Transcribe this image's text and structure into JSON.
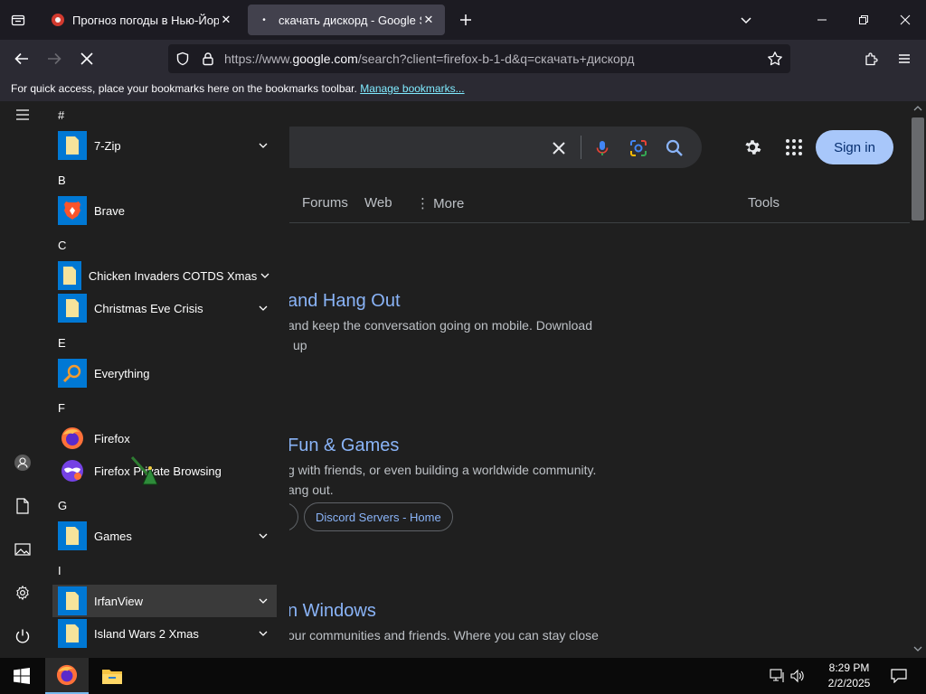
{
  "browser": {
    "tabs": [
      {
        "title": "Прогноз погоды в Нью-Йорке",
        "active": false
      },
      {
        "title": "скачать дискорд - Google Search",
        "active": true
      }
    ],
    "url": {
      "prefix": "https://www.",
      "host": "google.com",
      "rest": "/search?client=firefox-b-1-d&q=скачать+дискорд"
    },
    "bookmarks_notice": "For quick access, place your bookmarks here on the bookmarks toolbar.",
    "manage_bookmarks": "Manage bookmarks..."
  },
  "google": {
    "sign_in": "Sign in",
    "tabs": [
      "Forums",
      "Web",
      "More"
    ],
    "tools": "Tools",
    "results": [
      {
        "title": "and Hang Out",
        "line1": "and keep the conversation going on mobile. Download",
        "line2": "up"
      },
      {
        "title": "Fun & Games",
        "line1": "g with friends, or even building a worldwide community.",
        "line2": "ang out."
      },
      {
        "title": "n Windows",
        "line1": "our communities and friends. Where you can stay close"
      }
    ],
    "sitelink": "Discord Servers - Home"
  },
  "start_menu": {
    "groups": [
      {
        "letter": "#",
        "apps": [
          {
            "name": "7-Zip",
            "icon": "folder-icon",
            "expandable": true
          }
        ]
      },
      {
        "letter": "B",
        "apps": [
          {
            "name": "Brave",
            "icon": "brave-icon",
            "expandable": false
          }
        ]
      },
      {
        "letter": "C",
        "apps": [
          {
            "name": "Chicken Invaders COTDS Xmas",
            "icon": "folder-icon",
            "expandable": true
          },
          {
            "name": "Christmas Eve Crisis",
            "icon": "folder-icon",
            "expandable": true
          }
        ]
      },
      {
        "letter": "E",
        "apps": [
          {
            "name": "Everything",
            "icon": "search-icon",
            "expandable": false
          }
        ]
      },
      {
        "letter": "F",
        "apps": [
          {
            "name": "Firefox",
            "icon": "firefox-icon",
            "expandable": false
          },
          {
            "name": "Firefox Private Browsing",
            "icon": "private-browsing-icon",
            "expandable": false
          }
        ]
      },
      {
        "letter": "G",
        "apps": [
          {
            "name": "Games",
            "icon": "folder-icon",
            "expandable": true
          }
        ]
      },
      {
        "letter": "I",
        "apps": [
          {
            "name": "IrfanView",
            "icon": "folder-icon",
            "expandable": true,
            "highlighted": true
          },
          {
            "name": "Island Wars 2 Xmas",
            "icon": "folder-icon",
            "expandable": true
          }
        ]
      }
    ]
  },
  "taskbar": {
    "time": "8:29 PM",
    "date": "2/2/2025"
  },
  "colors": {
    "accent_blue": "#0078d4",
    "link_blue": "#8ab4f8",
    "signin_bg": "#a8c7fa"
  }
}
